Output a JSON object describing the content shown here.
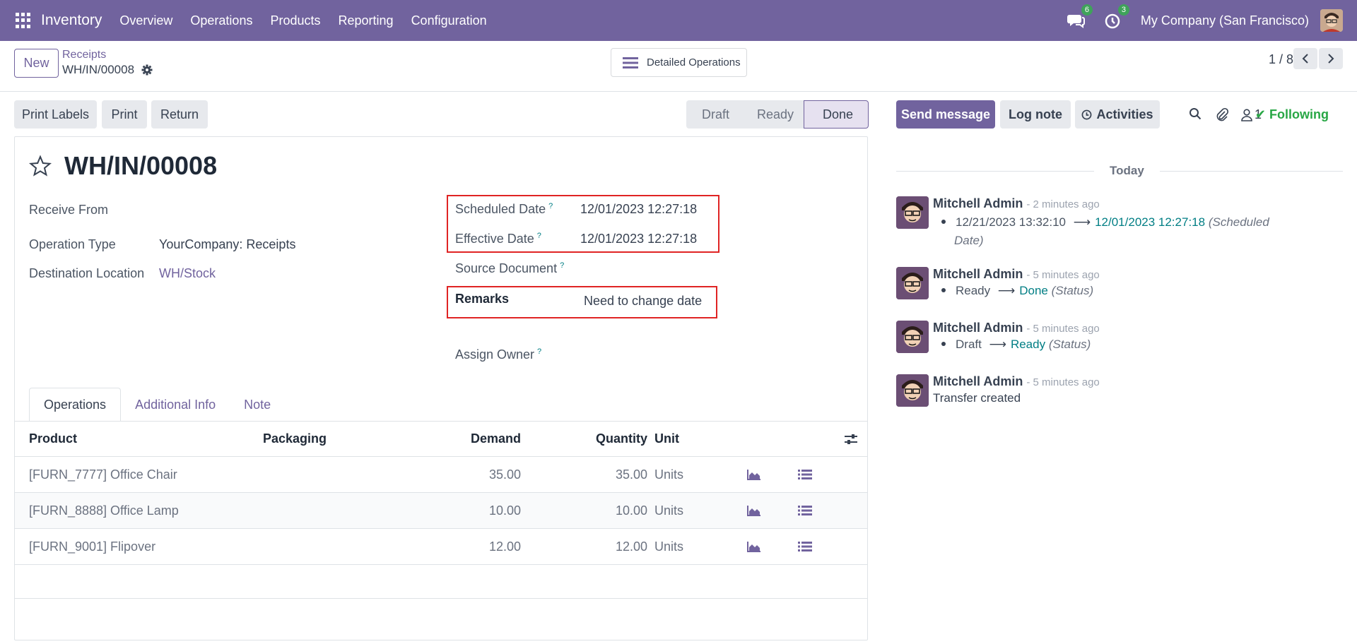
{
  "navbar": {
    "app_name": "Inventory",
    "menu": [
      "Overview",
      "Operations",
      "Products",
      "Reporting",
      "Configuration"
    ],
    "messages_count": "6",
    "activities_count": "3",
    "company": "My Company (San Francisco)"
  },
  "control_panel": {
    "new_label": "New",
    "breadcrumb_parent": "Receipts",
    "breadcrumb_current": "WH/IN/00008",
    "detailed_operations": "Detailed Operations",
    "pager": "1 / 8"
  },
  "actions": {
    "print_labels": "Print Labels",
    "print": "Print",
    "return": "Return"
  },
  "status": {
    "steps": [
      "Draft",
      "Ready",
      "Done"
    ],
    "current": "Done"
  },
  "form": {
    "title": "WH/IN/00008",
    "receive_from_label": "Receive From",
    "operation_type_label": "Operation Type",
    "operation_type_value": "YourCompany: Receipts",
    "destination_label": "Destination Location",
    "destination_value": "WH/Stock",
    "scheduled_date_label": "Scheduled Date",
    "scheduled_date_value": "12/01/2023 12:27:18",
    "effective_date_label": "Effective Date",
    "effective_date_value": "12/01/2023 12:27:18",
    "source_document_label": "Source Document",
    "remarks_label": "Remarks",
    "remarks_value": "Need to change date",
    "assign_owner_label": "Assign Owner",
    "help_mark": "?"
  },
  "tabs": [
    "Operations",
    "Additional Info",
    "Note"
  ],
  "table": {
    "headers": {
      "product": "Product",
      "packaging": "Packaging",
      "demand": "Demand",
      "quantity": "Quantity",
      "unit": "Unit"
    },
    "rows": [
      {
        "product": "[FURN_7777] Office Chair",
        "demand": "35.00",
        "quantity": "35.00",
        "unit": "Units"
      },
      {
        "product": "[FURN_8888] Office Lamp",
        "demand": "10.00",
        "quantity": "10.00",
        "unit": "Units"
      },
      {
        "product": "[FURN_9001] Flipover",
        "demand": "12.00",
        "quantity": "12.00",
        "unit": "Units"
      }
    ]
  },
  "chatter": {
    "send_message": "Send message",
    "log_note": "Log note",
    "activities": "Activities",
    "followers_count": "1",
    "following": "Following",
    "date_separator": "Today",
    "messages": [
      {
        "author": "Mitchell Admin",
        "time": "- 2 minutes ago",
        "old": "12/21/2023 13:32:10",
        "new": "12/01/2023 12:27:18",
        "field": "(Scheduled",
        "field2": "Date)"
      },
      {
        "author": "Mitchell Admin",
        "time": "- 5 minutes ago",
        "old": "Ready",
        "new": "Done",
        "field": "(Status)"
      },
      {
        "author": "Mitchell Admin",
        "time": "- 5 minutes ago",
        "old": "Draft",
        "new": "Ready",
        "field": "(Status)"
      },
      {
        "author": "Mitchell Admin",
        "time": "- 5 minutes ago",
        "text": "Transfer created"
      }
    ]
  }
}
